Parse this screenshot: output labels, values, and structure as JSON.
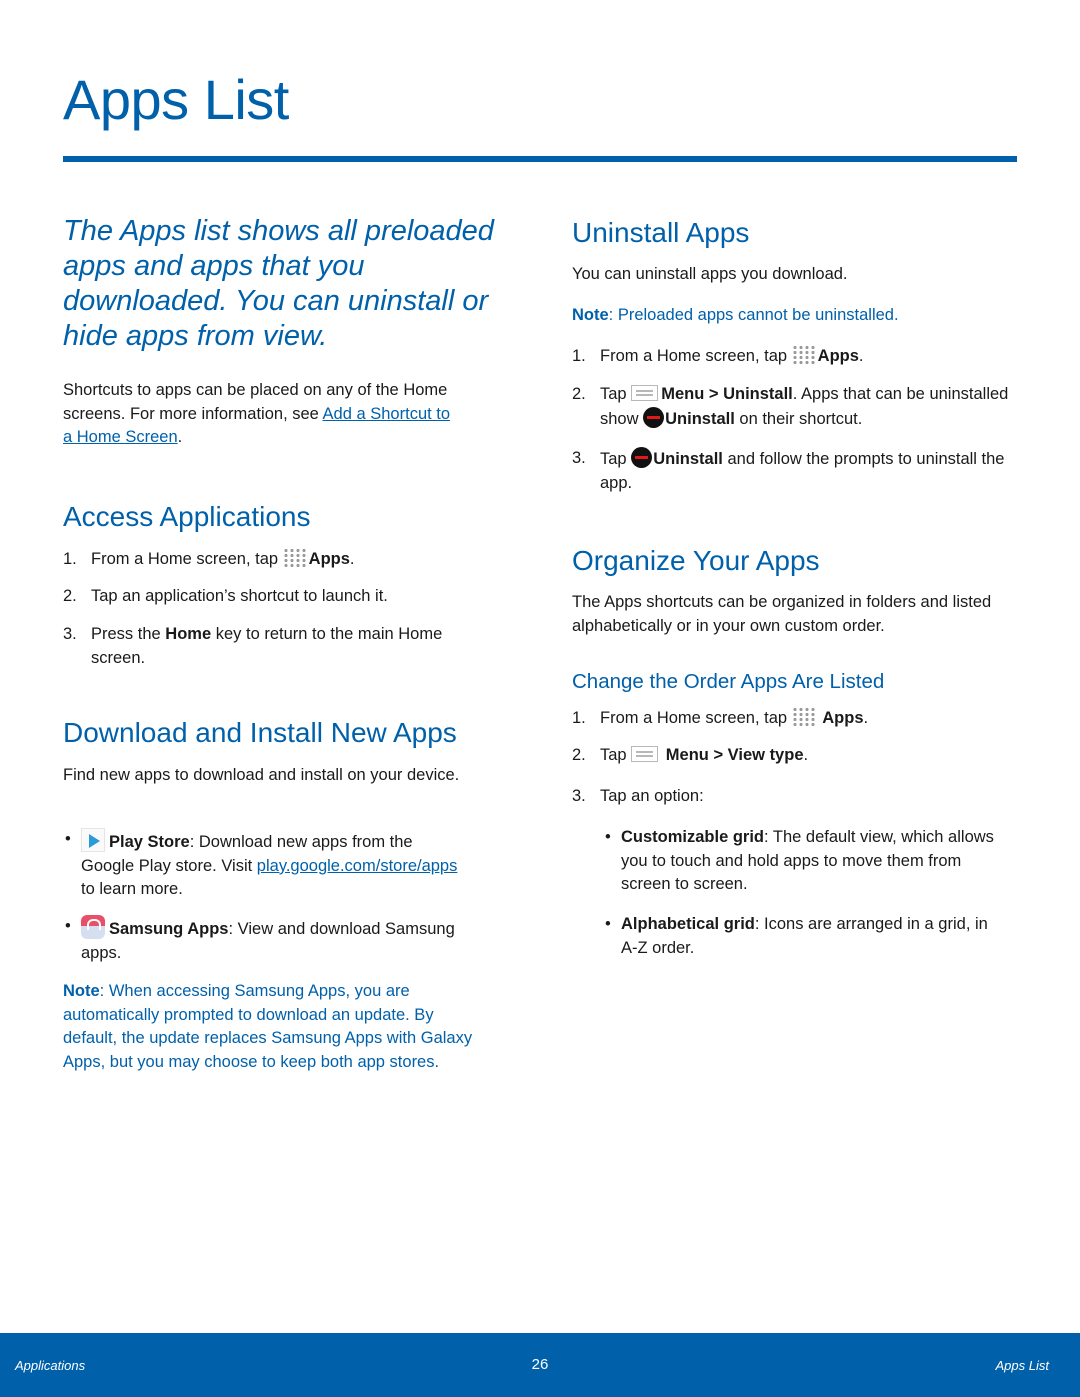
{
  "page": {
    "title": "Apps List",
    "intro": "The Apps list shows all preloaded apps and apps that you downloaded. You can uninstall or hide apps from view.",
    "shortcuts_text": "Shortcuts to apps can be placed on any of the Home screens. For more information, see",
    "shortcuts_link": "Add a Shortcut to a Home Screen",
    "period": "."
  },
  "access": {
    "heading": "Access Applications",
    "steps": [
      {
        "num": "1.",
        "pre": "From a Home screen, tap",
        "icon": "apps-grid-icon",
        "bold": "Apps",
        "post": "."
      },
      {
        "num": "2.",
        "text": "Tap an application’s shortcut to launch it."
      },
      {
        "num": "3.",
        "pre": "Press the",
        "bold": "Home",
        "post": "key to return to the main Home screen."
      }
    ]
  },
  "download": {
    "heading": "Download and Install New Apps",
    "intro": "Find new apps to download and install on your device.",
    "bullets": [
      {
        "icon": "play-store-icon",
        "bold": "Play Store",
        "text": ": Download new apps from the Google Play store. Visit",
        "link": "play.google.com/store/apps",
        "post": "to learn more."
      },
      {
        "icon": "samsung-apps-icon",
        "bold": "Samsung Apps",
        "text": ": View and download Samsung apps."
      }
    ],
    "note_label": "Note",
    "note_text": ": When accessing Samsung Apps, you are automatically prompted to download an update. By default, the update replaces Samsung Apps with Galaxy Apps, but you may choose to keep both app stores."
  },
  "uninstall": {
    "heading": "Uninstall Apps",
    "intro": "You can uninstall apps you download.",
    "note_label": "Note",
    "note_text": ": Preloaded apps cannot be uninstalled.",
    "steps": [
      {
        "num": "1.",
        "pre": "From a Home screen, tap",
        "bold": "Apps",
        "post": "."
      },
      {
        "num": "2.",
        "pre": "Tap",
        "bold1": "Menu > Uninstall",
        "mid": ". Apps that can be uninstalled show",
        "bold2": "Uninstall",
        "post": "on their shortcut."
      },
      {
        "num": "3.",
        "pre": "Tap",
        "bold": "Uninstall",
        "post": "and follow the prompts to uninstall the app."
      }
    ]
  },
  "organize": {
    "heading": "Organize Your Apps",
    "intro": "The Apps shortcuts can be organized in folders and listed alphabetically or in your own custom order.",
    "subheading": "Change the Order Apps Are Listed",
    "steps": [
      {
        "num": "1.",
        "pre": "From a Home screen, tap",
        "bold": "Apps",
        "post": "."
      },
      {
        "num": "2.",
        "pre": "Tap",
        "bold": "Menu > View type",
        "post": "."
      },
      {
        "num": "3.",
        "text": "Tap an option:"
      }
    ],
    "options": [
      {
        "bold": "Customizable grid",
        "text": ": The default view, which allows you to touch and hold apps to move them from screen to screen."
      },
      {
        "bold": "Alphabetical grid",
        "text": ": Icons are arranged in a grid, in A-Z order."
      }
    ]
  },
  "footer": {
    "left": "Applications",
    "page_number": "26",
    "right": "Apps List"
  },
  "bullet_char": "•",
  "colors": {
    "accent": "#0060aa",
    "text": "#1a1a1a",
    "minus_red": "#e01a1a"
  }
}
